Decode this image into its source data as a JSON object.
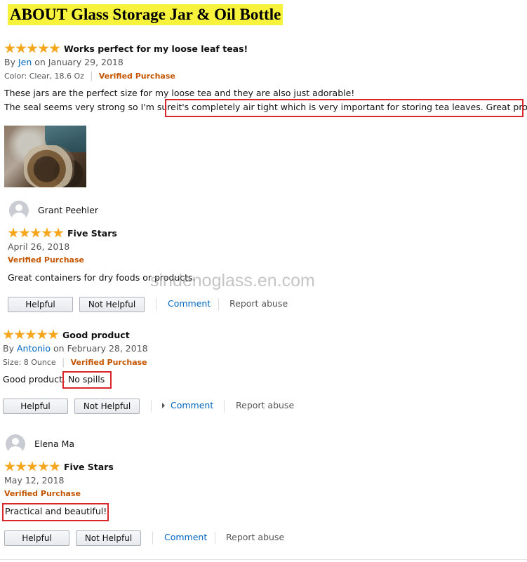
{
  "page_title": "ABOUT Glass Storage Jar & Oil Bottle",
  "watermark": "sindenoglass.en.com",
  "colors": {
    "star": "#f6a61c",
    "link": "#0066c0",
    "verified": "#c45500",
    "highlight": "#d9262c",
    "title_bg": "#f7f33c"
  },
  "reviews": [
    {
      "rating": 5,
      "title": "Works perfect for my loose leaf teas!",
      "by_prefix": "By",
      "author": "Jen",
      "date": "on January 29, 2018",
      "variant": "Color: Clear, 18.6 Oz",
      "verified": "Verified Purchase",
      "body_line1": "These jars are the perfect size for my loose tea and they are also just adorable!",
      "body_line2_a": "The seal seems very strong so I'm sure",
      "body_line2_b": "it's completely air tight which is very important for storing tea leaves. Great product!"
    },
    {
      "rating": 5,
      "author": "Grant Peehler",
      "title": "Five Stars",
      "date": "April 26, 2018",
      "verified": "Verified Purchase",
      "body": "Great containers for dry foods or products.",
      "actions": {
        "helpful": "Helpful",
        "not_helpful": "Not Helpful",
        "comment": "Comment",
        "report": "Report abuse"
      }
    },
    {
      "rating": 5,
      "title": "Good product",
      "by_prefix": "By",
      "author": "Antonio",
      "date": "on February 28, 2018",
      "variant": "Size: 8 Ounce",
      "verified": "Verified Purchase",
      "body_a": "Good product.",
      "body_b": "No spills",
      "actions": {
        "helpful": "Helpful",
        "not_helpful": "Not Helpful",
        "comment": "Comment",
        "report": "Report abuse"
      }
    },
    {
      "rating": 5,
      "author": "Elena Ma",
      "title": "Five Stars",
      "date": "May 12, 2018",
      "verified": "Verified Purchase",
      "body": "Practical and beautiful!",
      "actions": {
        "helpful": "Helpful",
        "not_helpful": "Not Helpful",
        "comment": "Comment",
        "report": "Report abuse"
      }
    }
  ]
}
